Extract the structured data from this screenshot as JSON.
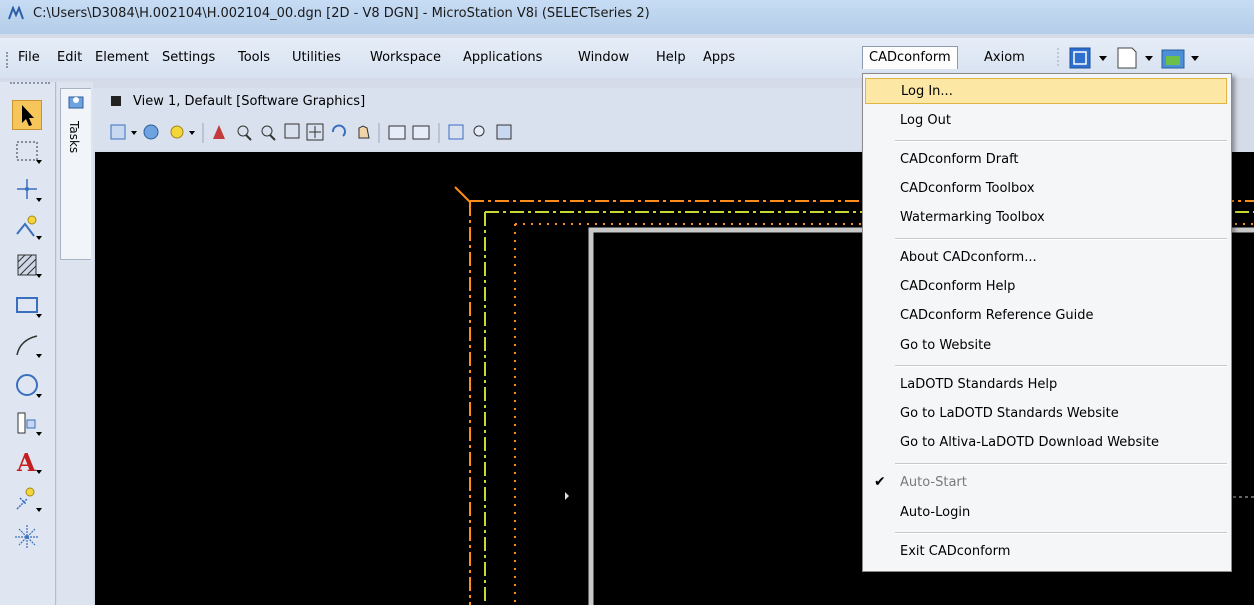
{
  "window": {
    "title": "C:\\Users\\D3084\\H.002104\\H.002104_00.dgn [2D - V8 DGN] - MicroStation V8i (SELECTseries 2)"
  },
  "menubar": {
    "items": [
      {
        "label": "File"
      },
      {
        "label": "Edit"
      },
      {
        "label": "Element"
      },
      {
        "label": "Settings"
      },
      {
        "label": "Tools"
      },
      {
        "label": "Utilities"
      },
      {
        "label": "Workspace"
      },
      {
        "label": "Applications"
      },
      {
        "label": "Window"
      },
      {
        "label": "Help"
      },
      {
        "label": "Apps"
      },
      {
        "label": "CADconform"
      },
      {
        "label": "Axiom"
      }
    ]
  },
  "tasks": {
    "tab_label": "Tasks"
  },
  "view": {
    "title": "View 1, Default [Software Graphics]"
  },
  "dropdown": {
    "items": [
      {
        "label": "Log In..."
      },
      {
        "label": "Log Out"
      },
      {
        "label": "CADconform Draft"
      },
      {
        "label": "CADconform Toolbox"
      },
      {
        "label": "Watermarking Toolbox"
      },
      {
        "label": "About CADconform..."
      },
      {
        "label": "CADconform Help"
      },
      {
        "label": "CADconform Reference Guide"
      },
      {
        "label": "Go to Website"
      },
      {
        "label": "LaDOTD Standards Help"
      },
      {
        "label": "Go to LaDOTD Standards Website"
      },
      {
        "label": "Go to Altiva-LaDOTD Download Website"
      },
      {
        "label": "Auto-Start"
      },
      {
        "label": "Auto-Login"
      },
      {
        "label": "Exit CADconform"
      }
    ]
  },
  "colors": {
    "canvas": "#000000",
    "menu_highlight": "#fde7a4",
    "orange_line": "#ff8c1a",
    "yellow_green_line": "#c8d830"
  }
}
